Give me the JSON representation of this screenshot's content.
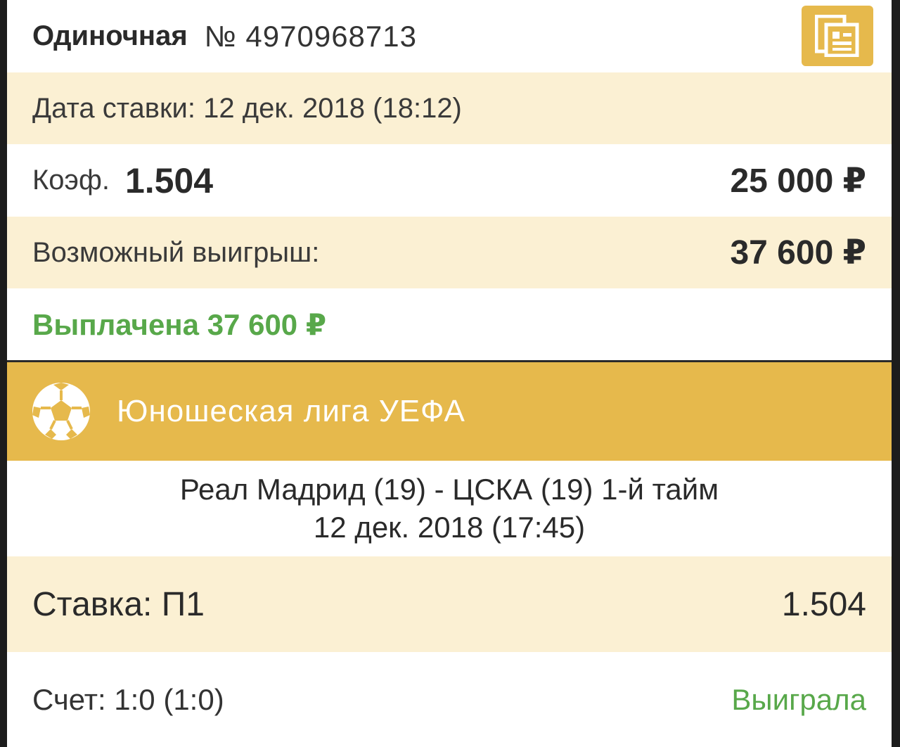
{
  "header": {
    "bet_type": "Одиночная",
    "bet_number": "№ 4970968713",
    "copy_icon": "copy-document-icon"
  },
  "bet_date": "Дата ставки: 12 дек. 2018 (18:12)",
  "coef": {
    "label": "Коэф.",
    "value": "1.504",
    "stake": "25 000 ₽"
  },
  "possible_win": {
    "label": "Возможный выигрыш:",
    "amount": "37 600 ₽"
  },
  "payout_status": "Выплачена 37 600 ₽",
  "league": {
    "icon": "soccer-ball-icon",
    "name": "Юношеская лига УЕФА"
  },
  "match": {
    "title": "Реал Мадрид (19) - ЦСКА (19) 1-й тайм",
    "date": "12 дек. 2018 (17:45)"
  },
  "selection": {
    "label": "Ставка: П1",
    "odd": "1.504"
  },
  "result": {
    "score": "Счет: 1:0 (1:0)",
    "status": "Выиграла"
  },
  "colors": {
    "accent": "#e6b94c",
    "cream": "#fbf0d3",
    "win_green": "#58a84a"
  }
}
